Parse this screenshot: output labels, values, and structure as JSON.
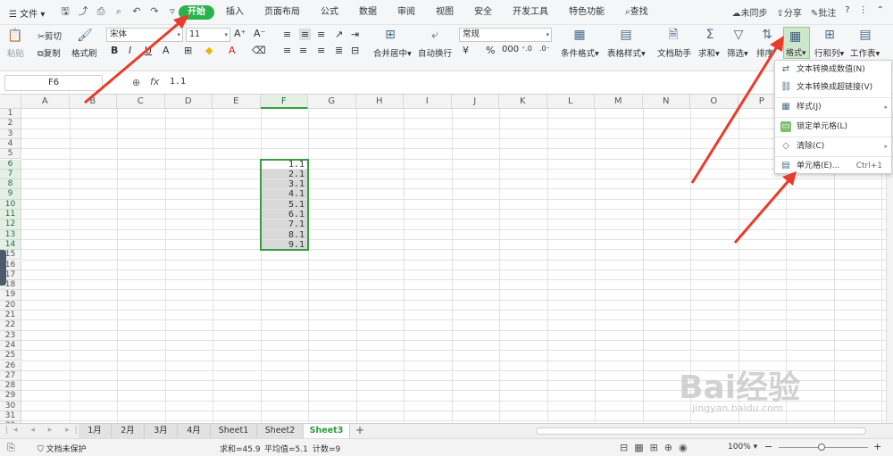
{
  "menubar": {
    "file_label": "文件",
    "tabs": [
      "开始",
      "插入",
      "页面布局",
      "公式",
      "数据",
      "审阅",
      "视图",
      "安全",
      "开发工具",
      "特色功能"
    ],
    "search_label": "查找",
    "sync_label": "未同步",
    "share_label": "分享",
    "comment_label": "批注"
  },
  "ribbon": {
    "paste": "粘贴",
    "cut": "剪切",
    "copy": "复制",
    "format_painter": "格式刷",
    "font_name": "宋体",
    "font_size": "11",
    "merge_center": "合并居中",
    "auto_wrap": "自动换行",
    "number_format": "常规",
    "cond_format": "条件格式",
    "table_style": "表格样式",
    "doc_helper": "文档助手",
    "sum": "求和",
    "filter": "筛选",
    "sort": "排序",
    "format": "格式",
    "row_col": "行和列",
    "worksheet": "工作表"
  },
  "formula_bar": {
    "name_box": "F6",
    "fx_label": "fx",
    "value": "1.1"
  },
  "columns": [
    "A",
    "B",
    "C",
    "D",
    "E",
    "F",
    "G",
    "H",
    "I",
    "J",
    "K",
    "L",
    "M",
    "N",
    "O",
    "P",
    "Q",
    "R"
  ],
  "rows": [
    "1",
    "2",
    "3",
    "4",
    "5",
    "6",
    "7",
    "8",
    "9",
    "10",
    "11",
    "12",
    "13",
    "14",
    "15",
    "16",
    "17",
    "18",
    "19",
    "20",
    "21",
    "22",
    "23",
    "24",
    "25",
    "26",
    "27",
    "28",
    "29",
    "30",
    "31",
    "32"
  ],
  "cells_f": [
    "1.1",
    "2.1",
    "3.1",
    "4.1",
    "5.1",
    "6.1",
    "7.1",
    "8.1",
    "9.1"
  ],
  "sheets": [
    "1月",
    "2月",
    "3月",
    "4月",
    "Sheet1",
    "Sheet2",
    "Sheet3"
  ],
  "active_sheet": "Sheet3",
  "status": {
    "protect": "文档未保护",
    "sum": "求和=45.9",
    "avg": "平均值=5.1",
    "count": "计数=9",
    "zoom": "100%"
  },
  "dropdown": {
    "items": [
      {
        "label": "文本转换成数值(N)"
      },
      {
        "label": "文本转换成超链接(V)"
      },
      {
        "label": "样式(J)"
      },
      {
        "label": "锁定单元格(L)"
      },
      {
        "label": "清除(C)"
      },
      {
        "label": "单元格(E)...",
        "shortcut": "Ctrl+1"
      }
    ]
  },
  "watermark": {
    "brand": "Bai经验",
    "sub": "jingyan.baidu.com"
  },
  "colors": {
    "accent": "#2bb24c",
    "selection": "#3a9a44",
    "arrow": "#e83b2c"
  }
}
